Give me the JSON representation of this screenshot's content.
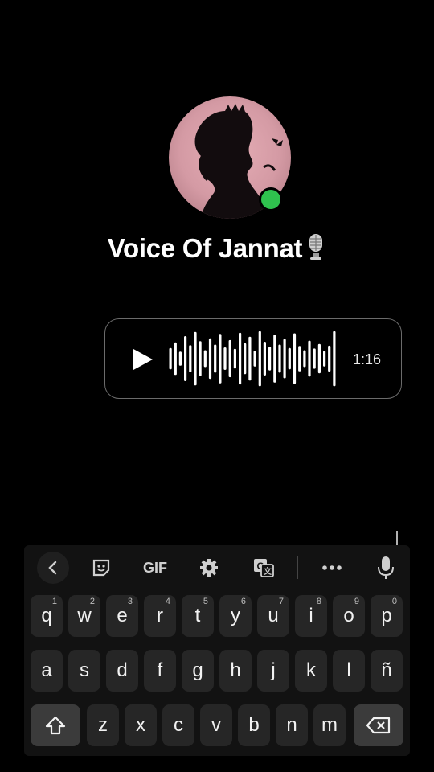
{
  "profile": {
    "name": "Voice Of Jannat",
    "mic_emoji": "mic-emoji-icon",
    "online": true,
    "online_color": "#2fc24e"
  },
  "voice_message": {
    "duration": "1:16",
    "waveform_heights": [
      0.38,
      0.58,
      0.25,
      0.8,
      0.48,
      0.95,
      0.62,
      0.3,
      0.72,
      0.5,
      0.88,
      0.4,
      0.66,
      0.35,
      0.92,
      0.55,
      0.78,
      0.28,
      0.98,
      0.6,
      0.42,
      0.85,
      0.5,
      0.7,
      0.38,
      0.9,
      0.45,
      0.3,
      0.64,
      0.36,
      0.52,
      0.28,
      0.46,
      0.98
    ]
  },
  "keyboard": {
    "toolbar": {
      "back": "chevron-left-icon",
      "sticker": "sticker-icon",
      "gif": "GIF",
      "settings": "gear-icon",
      "translate": "translate-icon",
      "more": "more-icon",
      "mic": "mic-icon"
    },
    "rows": [
      [
        {
          "k": "q",
          "n": "1"
        },
        {
          "k": "w",
          "n": "2"
        },
        {
          "k": "e",
          "n": "3"
        },
        {
          "k": "r",
          "n": "4"
        },
        {
          "k": "t",
          "n": "5"
        },
        {
          "k": "y",
          "n": "6"
        },
        {
          "k": "u",
          "n": "7"
        },
        {
          "k": "i",
          "n": "8"
        },
        {
          "k": "o",
          "n": "9"
        },
        {
          "k": "p",
          "n": "0"
        }
      ],
      [
        {
          "k": "a"
        },
        {
          "k": "s"
        },
        {
          "k": "d"
        },
        {
          "k": "f"
        },
        {
          "k": "g"
        },
        {
          "k": "h"
        },
        {
          "k": "j"
        },
        {
          "k": "k"
        },
        {
          "k": "l"
        },
        {
          "k": "ñ"
        }
      ],
      [
        {
          "k": "z"
        },
        {
          "k": "x"
        },
        {
          "k": "c"
        },
        {
          "k": "v"
        },
        {
          "k": "b"
        },
        {
          "k": "n"
        },
        {
          "k": "m"
        }
      ]
    ],
    "shift": "shift-icon",
    "backspace": "backspace-icon"
  }
}
